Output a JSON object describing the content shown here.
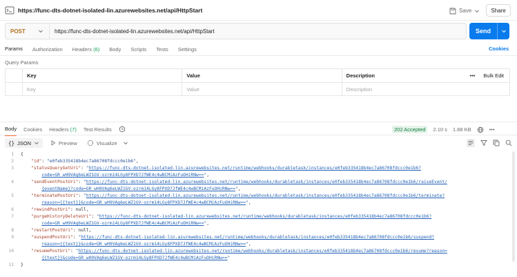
{
  "titlebar": {
    "url": "https://func-dts-dotnet-isolated-lin.azurewebsites.net/api/HttpStart",
    "save_label": "Save",
    "share_label": "Share"
  },
  "request": {
    "method": "POST",
    "url": "https://func-dts-dotnet-isolated-lin.azurewebsites.net/api/HttpStart",
    "send_label": "Send",
    "tabs": [
      {
        "label": "Params"
      },
      {
        "label": "Authorization"
      },
      {
        "label": "Headers",
        "count": "(6)"
      },
      {
        "label": "Body"
      },
      {
        "label": "Scripts"
      },
      {
        "label": "Tests"
      },
      {
        "label": "Settings"
      }
    ],
    "cookies_label": "Cookies",
    "section_title": "Query Params",
    "table": {
      "headers": [
        "Key",
        "Value",
        "Description"
      ],
      "bulk_edit_label": "Bulk Edit",
      "placeholders": [
        "Key",
        "Value",
        "Description"
      ]
    }
  },
  "response": {
    "tabs": [
      {
        "label": "Body"
      },
      {
        "label": "Cookies"
      },
      {
        "label": "Headers",
        "count": "(7)"
      },
      {
        "label": "Test Results"
      }
    ],
    "status_code": "202 Accepted",
    "time": "2.10 s",
    "size": "1.88 KB",
    "format": "JSON",
    "preview_label": "Preview",
    "visualize_label": "Visualize",
    "lines": {
      "l1": "{",
      "l2_key": "\"id\"",
      "l2_val": "\"e0feb335418b4ec7a86708fdccc0e1b6\"",
      "l3_key": "\"statusQueryGetUri\"",
      "l3_q": "\"",
      "l3_url1": "https://func-dts-dotnet-isolated-lin.azurewebsites.net/runtime/webhooks/durabletask/instances/e0feb335418b4ec7a86708fdccc0e1b6?",
      "l3_url2": "code=GR_wH9VAg6eLWZ1GV-ozrm14LGy8FPXD7JfWE4c4wBCMiAzFuOHiRNw==",
      "l4_key": "\"sendEventPostUri\"",
      "l4_url1": "https://func-dts-dotnet-isolated-lin.azurewebsites.net/runtime/webhooks/durabletask/instances/e0feb335418b4ec7a86708fdccc0e1b6/raiseEvent/",
      "l4_url2": "{eventName}?code=GR_wH9VAg6eLWZ1GV-ozrm14LGy8FPXD7JfWE4c4wBCMiAzFuOHiRNw==",
      "l5_key": "\"terminatePostUri\"",
      "l5_url1": "https://func-dts-dotnet-isolated-lin.azurewebsites.net/runtime/webhooks/durabletask/instances/e0feb335418b4ec7a86708fdccc0e1b6/terminate?",
      "l5_url2": "reason={{text}}&code=GR_wH9VAg6eLWZ1GV-ozrm14LGy8FPXD7JfWE4c4wBCMiAzFuOHiRNw==",
      "l6_key": "\"rewindPostUri\"",
      "null_val": "null",
      "l7_key": "\"purgeHistoryDeleteUri\"",
      "l7_url1": "https://func-dts-dotnet-isolated-lin.azurewebsites.net/runtime/webhooks/durabletask/instances/e0feb335418b4ec7a86708fdccc0e1b6?",
      "l7_url2": "code=GR_wH9VAg6eLWZ1GV-ozrm14LGy8FPXD7JfWE4c4wBCMiAzFuOHiRNw==",
      "l8_key": "\"restartPostUri\"",
      "l9_key": "\"suspendPostUri\"",
      "l9_url1": "https://func-dts-dotnet-isolated-lin.azurewebsites.net/runtime/webhooks/durabletask/instances/e0feb335418b4ec7a86708fdccc0e1b6/suspend?",
      "l9_url2": "reason={{text}}&code=GR_wH9VAg6eLWZ1GV-ozrm14LGy8FPXD7JfWE4c4wBCMiAzFuOHiRNw==",
      "l10_key": "\"resumePostUri\"",
      "l10_url1": "https://func-dts-dotnet-isolated-lin.azurewebsites.net/runtime/webhooks/durabletask/instances/e0feb335418b4ec7a86708fdccc0e1b6/resume?reason=",
      "l10_url2": "{{text}}&code=GR_wH9VAg6eLWZ1GV-ozrm14LGy8FPXD7JfWE4c4wBCMiAzFuOHiRNw==",
      "l11": "}",
      "colon": ": ",
      "comma": ","
    },
    "line_numbers": [
      "1",
      "2",
      "3",
      "4",
      "5",
      "6",
      "7",
      "8",
      "9",
      "10",
      "11"
    ]
  },
  "colors": {
    "accent_send": "#097bed",
    "method_post": "#b1701a",
    "active_tab": "#ff6c37",
    "status_ok": "#0f7b3d"
  }
}
